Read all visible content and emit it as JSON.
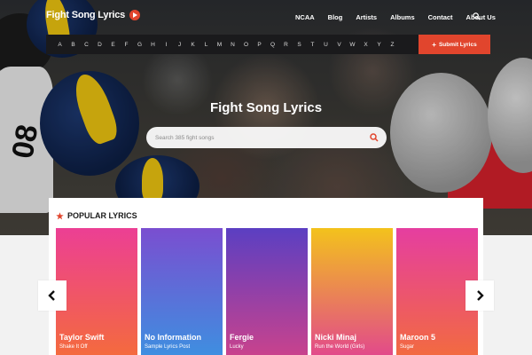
{
  "brand": {
    "logo_text": "Fight Song Lyrics",
    "accent": "#e1452d"
  },
  "nav": {
    "items": [
      "NCAA",
      "Blog",
      "Artists",
      "Albums",
      "Contact",
      "About Us"
    ]
  },
  "alphabet": [
    "A",
    "B",
    "C",
    "D",
    "E",
    "F",
    "G",
    "H",
    "I",
    "J",
    "K",
    "L",
    "M",
    "N",
    "O",
    "P",
    "Q",
    "R",
    "S",
    "T",
    "U",
    "V",
    "W",
    "X",
    "Y",
    "Z"
  ],
  "submit_label": "Submit Lyrics",
  "hero": {
    "title": "Fight Song Lyrics",
    "search_placeholder": "Search 385 fight songs"
  },
  "popular": {
    "title": "POPULAR LYRICS",
    "cards": [
      {
        "name": "Taylor Swift",
        "subtitle": "Shake It Off",
        "gradient": [
          "#ec3f94",
          "#f46a3e"
        ]
      },
      {
        "name": "No Information",
        "subtitle": "Sample Lyrics Post",
        "gradient": [
          "#7a4ed0",
          "#3f8ee0"
        ]
      },
      {
        "name": "Fergie",
        "subtitle": "Lucky",
        "gradient": [
          "#5b3fc2",
          "#c8428d"
        ]
      },
      {
        "name": "Nicki Minaj",
        "subtitle": "Run the World (Girls)",
        "gradient": [
          "#f3c21c",
          "#e24a8a"
        ]
      },
      {
        "name": "Maroon 5",
        "subtitle": "Sugar",
        "gradient": [
          "#e53ea0",
          "#f26a41"
        ]
      }
    ]
  },
  "icons": {
    "search": "search-icon",
    "play": "play-icon",
    "star": "star-icon",
    "arrow_left": "chevron-left-icon",
    "arrow_right": "chevron-right-icon"
  }
}
